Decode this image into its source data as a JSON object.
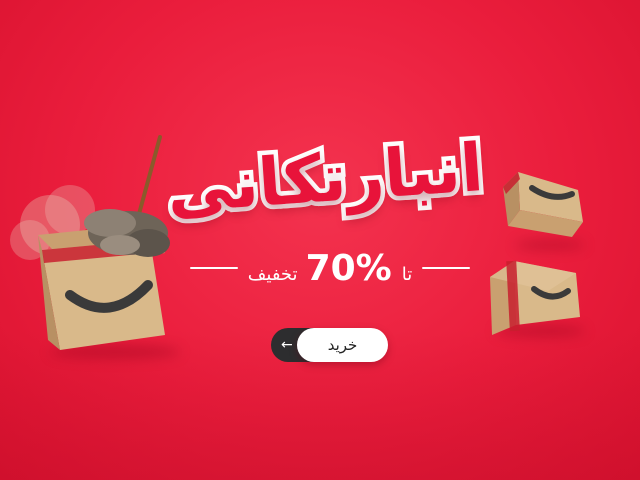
{
  "banner": {
    "title": "انبارتکانی",
    "discount": {
      "prefix": "تا",
      "percent": "70%",
      "suffix": "تخفیف"
    },
    "buy_button": {
      "label": "خرید",
      "arrow_icon": "arrow-left-icon"
    },
    "colors": {
      "background": "#ea1d3c",
      "title_fill": "#e8133a",
      "title_stroke": "#ffffff",
      "box": "#d9b98a",
      "smile": "#3a3a3a",
      "tape": "#c81e2e",
      "button_dark": "#2d2d2f"
    }
  }
}
